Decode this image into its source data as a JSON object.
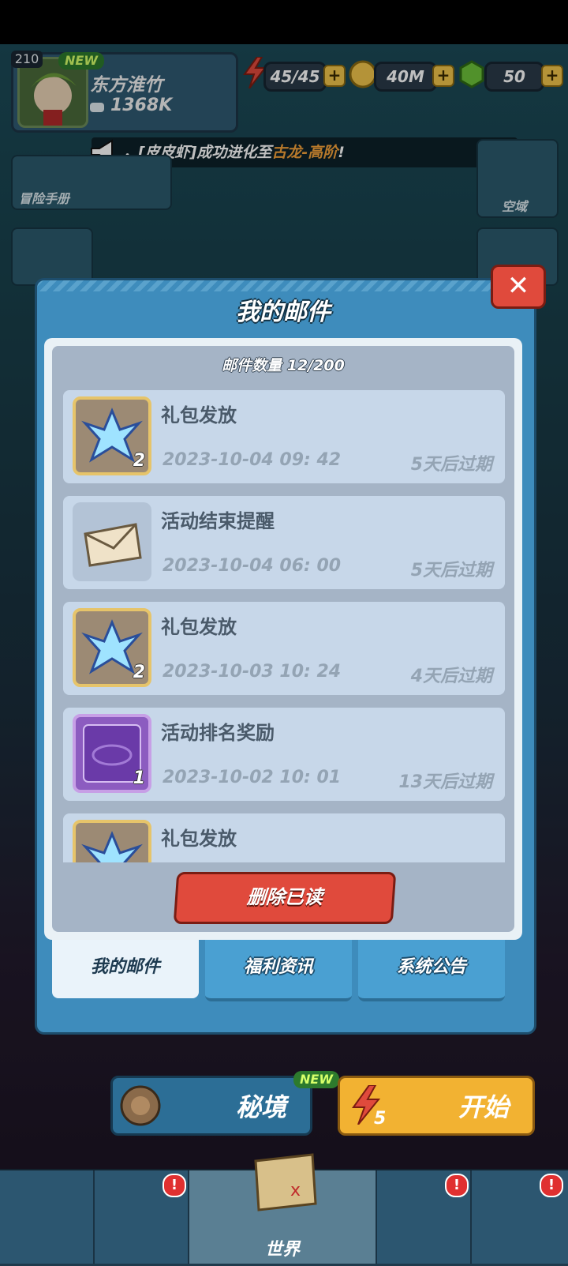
{
  "hud": {
    "level": "210",
    "new_tag": "NEW",
    "player_name": "东方淮竹",
    "power": "1368K",
    "stamina": "45/45",
    "gold": "40M",
    "gems": "50",
    "plus": "+"
  },
  "marquee": {
    "prefix": "，[皮皮虾]成功进化至",
    "highlight": "古龙-高阶",
    "suffix": "!"
  },
  "side": {
    "adventure_book": "冒险手册",
    "sky_domain": "空域"
  },
  "modal": {
    "title": "我的邮件",
    "close": "✕",
    "count_label": "邮件数量 12/200",
    "delete_read": "删除已读",
    "mails": [
      {
        "title": "礼包发放",
        "date": "2023-10-04 09: 42",
        "expire": "5天后过期",
        "icon": "gift-crystal-icon",
        "qty": "2"
      },
      {
        "title": "活动结束提醒",
        "date": "2023-10-04 06: 00",
        "expire": "5天后过期",
        "icon": "envelope-icon",
        "qty": ""
      },
      {
        "title": "礼包发放",
        "date": "2023-10-03 10: 24",
        "expire": "4天后过期",
        "icon": "gift-crystal-icon",
        "qty": "2"
      },
      {
        "title": "活动排名奖励",
        "date": "2023-10-02 10: 01",
        "expire": "13天后过期",
        "icon": "purple-card-icon",
        "qty": "1"
      },
      {
        "title": "礼包发放",
        "date": "",
        "expire": "",
        "icon": "gift-crystal-icon",
        "qty": ""
      }
    ],
    "tabs": [
      {
        "label": "我的邮件",
        "active": true
      },
      {
        "label": "福利资讯",
        "active": false
      },
      {
        "label": "系统公告",
        "active": false
      }
    ]
  },
  "bottom": {
    "secret_realm": "秘境",
    "secret_new": "NEW",
    "start": "开始",
    "start_cost": "5",
    "world": "世界",
    "badge": "!"
  },
  "colors": {
    "modal_blue": "#3e8cbc",
    "danger_red": "#e04a3c",
    "highlight_orange": "#f4a23a"
  }
}
